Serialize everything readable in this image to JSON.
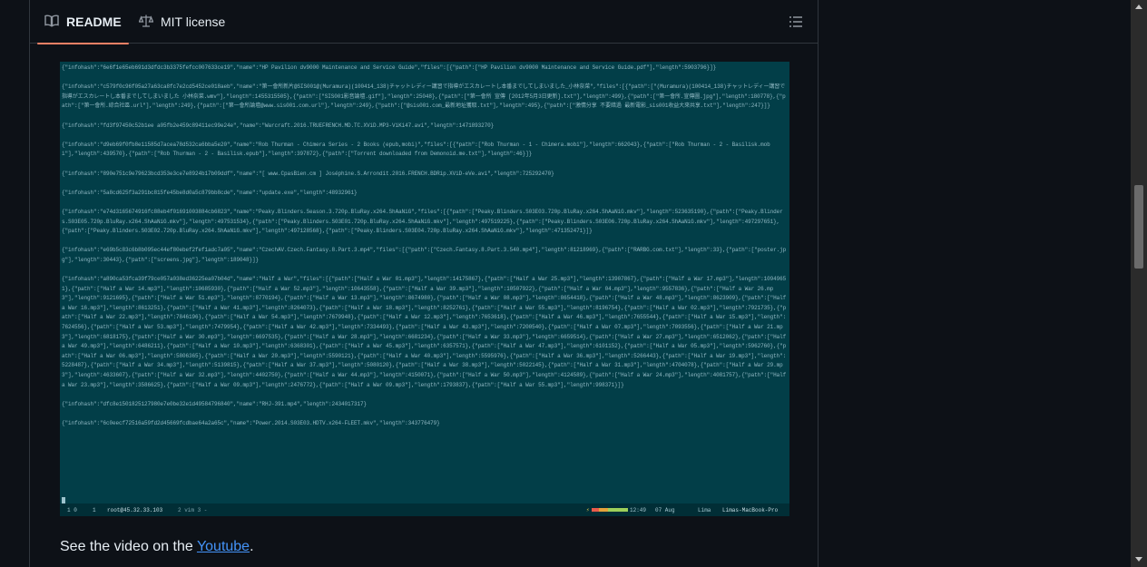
{
  "tabs": {
    "readme_label": "README",
    "license_label": "MIT license"
  },
  "terminal": {
    "lines": [
      "{\"infohash\":\"6e6f1e65eb691d3dfdc3b3375fefcc007633ce19\",\"name\":\"HP Pavilion dv9000 Maintenance and Service Guide\",\"files\":[{\"path\":[\"HP Pavilion dv9000 Maintenance and Service Guide.pdf\"],\"length\":5903796}]}",
      "{\"infohash\":\"c579f0c96f05a27a63ca8fc7e2cd5452ce018aeb\",\"name\":\"第一會所新片@SIS001@(Muramura)(100414_138)チャットレディー講習で指導がエスカレートし本番までしてしまいました_小林奈菜\",\"files\":[{\"path\":[\"(Muramura)(100414_138)チャットレディー講習で指導がエスカレートし本番までしてしまいました 小林奈菜.wmv\"],\"length\":1455315505},{\"path\":[\"SIS001影音論壇.gif\"],\"length\":25048},{\"path\":[\"第一會所 宣傳 [2012年5月3日更新].txt\"],\"length\":499},{\"path\":[\"第一會所.宣傳圖.jpg\"],\"length\":180778},{\"path\":[\"第一會所.綜合社區.url\"],\"length\":249},{\"path\":[\"第一會所論壇@www.sis001.com.url\"],\"length\":249},{\"path\":[\"@sis001.com_最新地址獲取.txt\"],\"length\":495},{\"path\":[\"激情分享 不要錯過 最新電影_sis001收益大來共享.txt\"],\"length\":247}]}",
      "{\"infohash\":\"fd3f97450c52b1ee a05fb2e459c89411ec99e24e\",\"name\":\"Warcraft.2016.TRUEFRENCH.MD.TC.XViD.MP3-ViKi47.avi\",\"length\":1471893270}",
      "{\"infohash\":\"d9eb69f0fb8e11585d7acea78d532ca6bba5e20\",\"name\":\"Rob Thurman - Chimera Series - 2 Books (epub,mobi)\",\"files\":[{\"path\":[\"Rob Thurman - 1 - Chimera.mobi\"],\"length\":662043},{\"path\":[\"Rob Thurman - 2 - Basilisk.mobi\"],\"length\":439570},{\"path\":[\"Rob Thurman - 2 - Basilisk.epub\"],\"length\":397872},{\"path\":[\"Torrent downloaded from Demonoid.me.txt\"],\"length\":46}]}",
      "{\"infohash\":\"890e751c9e79623bcd353e3ce7e8924b17b09ddf\",\"name\":\"[ www.CpasBien.cm ] Joséphine.S.Arrondit.2016.FRENCH.BDRip.XViD-eVe.avi\",\"length\":725292470}",
      "{\"infohash\":\"5a8cd625f3a291bc815fe45be8d0a5c879bb8cde\",\"name\":\"update.exe\",\"length\":48932961}",
      "{\"infohash\":\"e74d3165674916fc88eb4f01691003884cb6823\",\"name\":\"Peaky.Blinders.Season.3.720p.BluRay.x264.ShAaNiG\",\"files\":[{\"path\":[\"Peaky.Blinders.S03E03.720p.BluRay.x264.ShAaNiG.mkv\"],\"length\":523635190},{\"path\":[\"Peaky.Blinders.S03E05.720p.BluRay.x264.ShAaNiG.mkv\"],\"length\":497531534},{\"path\":[\"Peaky.Blinders.S03E01.720p.BluRay.x264.ShAaNiG.mkv\"],\"length\":497519225},{\"path\":[\"Peaky.Blinders.S03E06.720p.BluRay.x264.ShAaNiG.mkv\"],\"length\":497297651},{\"path\":[\"Peaky.Blinders.S03E02.720p.BluRay.x264.ShAaNiG.mkv\"],\"length\":497128568},{\"path\":[\"Peaky.Blinders.S03E04.720p.BluRay.x264.ShAaNiG.mkv\"],\"length\":471352471}]}",
      "{\"infohash\":\"e69b5c83c6b8b095ec44ef80ebef2fef1adc7a05\",\"name\":\"CzechAV.Czech.Fantasy.8.Part.3.mp4\",\"files\":[{\"path\":[\"Czech.Fantasy.8.Part.3.540.mp4\"],\"length\":81218969},{\"path\":[\"RARBG.com.txt\"],\"length\":33},{\"path\":[\"poster.jpg\"],\"length\":30443},{\"path\":[\"screens.jpg\"],\"length\":189048}]}",
      "{\"infohash\":\"a890ca53fca39f79ce057a038ed36225ea07b04d\",\"name\":\"Half a War\",\"files\":[{\"path\":[\"Half a War 01.mp3\"],\"length\":14175867},{\"path\":[\"Half a War 25.mp3\"],\"length\":13907867},{\"path\":[\"Half a War 17.mp3\"],\"length\":10949651},{\"path\":[\"Half a War 14.mp3\"],\"length\":10685930},{\"path\":[\"Half a War 52.mp3\"],\"length\":10643558},{\"path\":[\"Half a War 39.mp3\"],\"length\":10507922},{\"path\":[\"Half a War 04.mp3\"],\"length\":9557836},{\"path\":[\"Half a War 26.mp3\"],\"length\":9121695},{\"path\":[\"Half a War 51.mp3\"],\"length\":8770194},{\"path\":[\"Half a War 13.mp3\"],\"length\":8674980},{\"path\":[\"Half a War 08.mp3\"],\"length\":8654418},{\"path\":[\"Half a War 48.mp3\"],\"length\":8623909},{\"path\":[\"Half a War 16.mp3\"],\"length\":8613251},{\"path\":[\"Half a War 41.mp3\"],\"length\":8264073},{\"path\":[\"Half a War 18.mp3\"],\"length\":8252761},{\"path\":[\"Half a War 55.mp3\"],\"length\":8196754},{\"path\":[\"Half a War 02.mp3\"],\"length\":7921735},{\"path\":[\"Half a War 22.mp3\"],\"length\":7846196},{\"path\":[\"Half a War 54.mp3\"],\"length\":7679948},{\"path\":[\"Half a War 12.mp3\"],\"length\":7653618},{\"path\":[\"Half a War 46.mp3\"],\"length\":7655544},{\"path\":[\"Half a War 15.mp3\"],\"length\":7624556},{\"path\":[\"Half a War 53.mp3\"],\"length\":7479954},{\"path\":[\"Half a War 42.mp3\"],\"length\":7334493},{\"path\":[\"Half a War 43.mp3\"],\"length\":7200540},{\"path\":[\"Half a War 07.mp3\"],\"length\":7093556},{\"path\":[\"Half a War 21.mp3\"],\"length\":6818175},{\"path\":[\"Half a War 30.mp3\"],\"length\":6697535},{\"path\":[\"Half a War 28.mp3\"],\"length\":6681234},{\"path\":[\"Half a War 33.mp3\"],\"length\":6659514},{\"path\":[\"Half a War 27.mp3\"],\"length\":6512062},{\"path\":[\"Half a War 49.mp3\"],\"length\":6486211},{\"path\":[\"Half a War 10.mp3\"],\"length\":6368301},{\"path\":[\"Half a War 45.mp3\"],\"length\":6357571},{\"path\":[\"Half a War 47.mp3\"],\"length\":6101152},{\"path\":[\"Half a War 05.mp3\"],\"length\":5962760},{\"path\":[\"Half a War 06.mp3\"],\"length\":5806365},{\"path\":[\"Half a War 20.mp3\"],\"length\":5590121},{\"path\":[\"Half a War 40.mp3\"],\"length\":5595976},{\"path\":[\"Half a War 36.mp3\"],\"length\":5266443},{\"path\":[\"Half a War 19.mp3\"],\"length\":5228487},{\"path\":[\"Half a War 34.mp3\"],\"length\":5139815},{\"path\":[\"Half a War 37.mp3\"],\"length\":5080120},{\"path\":[\"Half a War 38.mp3\"],\"length\":5022145},{\"path\":[\"Half a War 31.mp3\"],\"length\":4704078},{\"path\":[\"Half a War 29.mp3\"],\"length\":4633607},{\"path\":[\"Half a War 32.mp3\"],\"length\":4402750},{\"path\":[\"Half a War 44.mp3\"],\"length\":4150071},{\"path\":[\"Half a War 50.mp3\"],\"length\":4124589},{\"path\":[\"Half a War 24.mp3\"],\"length\":4081757},{\"path\":[\"Half a War 23.mp3\"],\"length\":3586625},{\"path\":[\"Half a War 09.mp3\"],\"length\":2476772},{\"path\":[\"Half a War 09.mp3\"],\"length\":1793837},{\"path\":[\"Half a War 55.mp3\"],\"length\":998371}]}",
      "{\"infohash\":\"dfc8e1501825127980e7e0be32e1d49584796840\",\"name\":\"RHJ-391.mp4\",\"length\":2434017317}",
      "{\"infohash\":\"6c0eecf72516a59fd2d45669fcdbae64a2a65c\",\"name\":\"Power.2014.S03E03.HDTV.x264-FLEET.mkv\",\"length\":343776479}"
    ],
    "status": {
      "left": "1 0",
      "pane": "1",
      "host": "root@45.32.33.103",
      "vim": "2 vim 3 -",
      "time": "12:49",
      "date": "07 Aug",
      "tag": "Lima",
      "machine": "Limas-MacBook-Pro"
    }
  },
  "footer": {
    "prefix": "See the video on the ",
    "link": "Youtube",
    "suffix": "."
  }
}
